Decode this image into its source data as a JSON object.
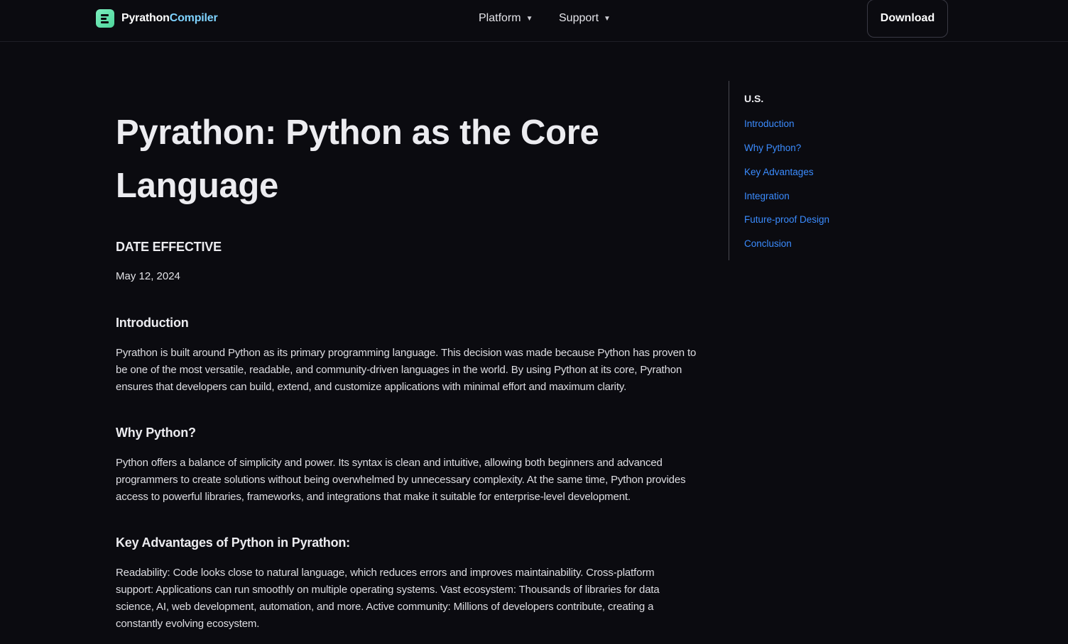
{
  "header": {
    "logo_primary": "Pyrathon",
    "logo_accent": "Compiler",
    "nav": [
      {
        "label": "Platform"
      },
      {
        "label": "Support"
      }
    ],
    "download_label": "Download"
  },
  "article": {
    "title": "Pyrathon: Python as the Core Language",
    "date_label": "DATE EFFECTIVE",
    "date_value": "May 12, 2024",
    "sections": [
      {
        "heading": "Introduction",
        "body": "Pyrathon is built around Python as its primary programming language. This decision was made because Python has proven to be one of the most versatile, readable, and community-driven languages in the world. By using Python at its core, Pyrathon ensures that developers can build, extend, and customize applications with minimal effort and maximum clarity."
      },
      {
        "heading": "Why Python?",
        "body": "Python offers a balance of simplicity and power. Its syntax is clean and intuitive, allowing both beginners and advanced programmers to create solutions without being overwhelmed by unnecessary complexity. At the same time, Python provides access to powerful libraries, frameworks, and integrations that make it suitable for enterprise-level development."
      },
      {
        "heading": "Key Advantages of Python in Pyrathon:",
        "body": "Readability: Code looks close to natural language, which reduces errors and improves maintainability. Cross-platform support: Applications can run smoothly on multiple operating systems. Vast ecosystem: Thousands of libraries for data science, AI, web development, automation, and more. Active community: Millions of developers contribute, creating a constantly evolving ecosystem."
      }
    ]
  },
  "toc": {
    "title": "U.S.",
    "items": [
      {
        "label": "Introduction"
      },
      {
        "label": "Why Python?"
      },
      {
        "label": "Key Advantages"
      },
      {
        "label": "Integration"
      },
      {
        "label": "Future-proof Design"
      },
      {
        "label": "Conclusion"
      }
    ]
  },
  "colors": {
    "background": "#0b0b10",
    "link": "#3b8cff",
    "logo_accent": "#7fd3ff",
    "logo_mark": "#5ee3a8"
  }
}
